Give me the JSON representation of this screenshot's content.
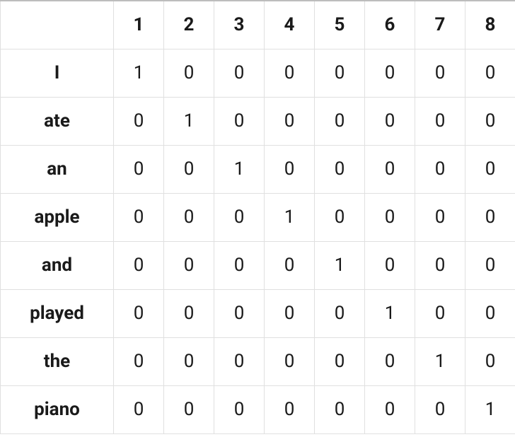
{
  "chart_data": {
    "type": "table",
    "title": "",
    "columns": [
      "1",
      "2",
      "3",
      "4",
      "5",
      "6",
      "7",
      "8"
    ],
    "rows": [
      "I",
      "ate",
      "an",
      "apple",
      "and",
      "played",
      "the",
      "piano"
    ],
    "values": [
      [
        1,
        0,
        0,
        0,
        0,
        0,
        0,
        0
      ],
      [
        0,
        1,
        0,
        0,
        0,
        0,
        0,
        0
      ],
      [
        0,
        0,
        1,
        0,
        0,
        0,
        0,
        0
      ],
      [
        0,
        0,
        0,
        1,
        0,
        0,
        0,
        0
      ],
      [
        0,
        0,
        0,
        0,
        1,
        0,
        0,
        0
      ],
      [
        0,
        0,
        0,
        0,
        0,
        1,
        0,
        0
      ],
      [
        0,
        0,
        0,
        0,
        0,
        0,
        1,
        0
      ],
      [
        0,
        0,
        0,
        0,
        0,
        0,
        0,
        1
      ]
    ]
  }
}
